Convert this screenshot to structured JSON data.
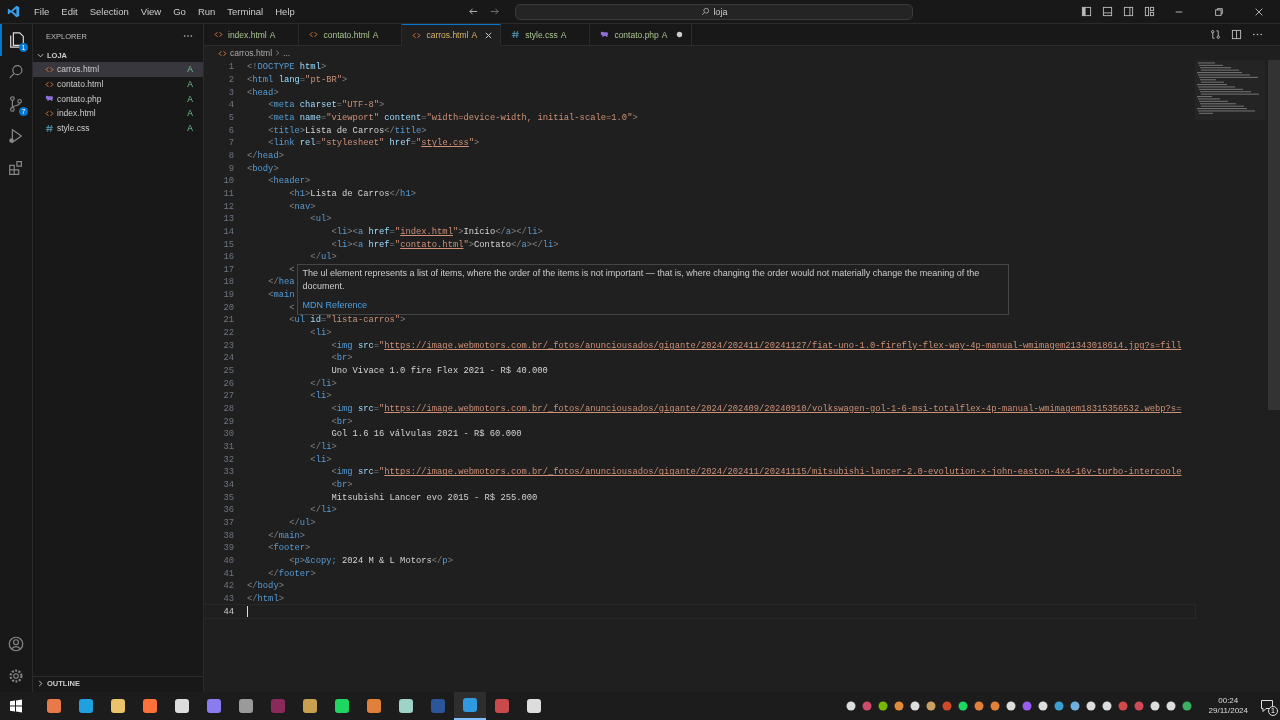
{
  "window": {
    "menu": [
      "File",
      "Edit",
      "Selection",
      "View",
      "Go",
      "Run",
      "Terminal",
      "Help"
    ],
    "search": "loja"
  },
  "activity_bar": {
    "explorer_badge": "1",
    "source_control_badge": "7"
  },
  "explorer": {
    "title": "EXPLORER",
    "folder": {
      "name": "LOJA",
      "expanded": true,
      "files": [
        {
          "name": "carros.html",
          "kind": "html",
          "badge": "A",
          "selected": true
        },
        {
          "name": "contato.html",
          "kind": "html",
          "badge": "A",
          "selected": false
        },
        {
          "name": "contato.php",
          "kind": "php",
          "badge": "A",
          "selected": false
        },
        {
          "name": "index.html",
          "kind": "html",
          "badge": "A",
          "selected": false
        },
        {
          "name": "style.css",
          "kind": "css",
          "badge": "A",
          "selected": false
        }
      ]
    }
  },
  "outline": {
    "label": "OUTLINE",
    "expanded": false
  },
  "tabs": [
    {
      "label": "index.html",
      "kind": "html",
      "badge": "A",
      "selected": false,
      "dirty": false
    },
    {
      "label": "contato.html",
      "kind": "html",
      "badge": "A",
      "selected": false,
      "dirty": false
    },
    {
      "label": "carros.html",
      "kind": "html",
      "badge": "A",
      "selected": true,
      "dirty": false
    },
    {
      "label": "style.css",
      "kind": "css",
      "badge": "A",
      "selected": false,
      "dirty": false
    },
    {
      "label": "contato.php",
      "kind": "php",
      "badge": "A",
      "selected": false,
      "dirty": true
    }
  ],
  "breadcrumb": [
    "carros.html",
    "..."
  ],
  "lines": [
    {
      "number": "1",
      "text": "<!DOCTYPE html>",
      "current": false
    },
    {
      "number": "2",
      "text": "<html lang=\"pt-BR\">",
      "current": false
    },
    {
      "number": "3",
      "text": "<head>",
      "current": false
    },
    {
      "number": "4",
      "text": "    <meta charset=\"UTF-8\">",
      "current": false
    },
    {
      "number": "5",
      "text": "    <meta name=\"viewport\" content=\"width=device-width, initial-scale=1.0\">",
      "current": false
    },
    {
      "number": "6",
      "text": "    <title>Lista de Carros</title>",
      "current": false
    },
    {
      "number": "7",
      "text": "    <link rel=\"stylesheet\" href=\"style.css\">",
      "current": false
    },
    {
      "number": "8",
      "text": "</head>",
      "current": false
    },
    {
      "number": "9",
      "text": "<body>",
      "current": false
    },
    {
      "number": "10",
      "text": "    <header>",
      "current": false
    },
    {
      "number": "11",
      "text": "        <h1>Lista de Carros</h1>",
      "current": false
    },
    {
      "number": "12",
      "text": "        <nav>",
      "current": false
    },
    {
      "number": "13",
      "text": "            <ul>",
      "current": false
    },
    {
      "number": "14",
      "text": "                <li><a href=\"index.html\">Início</a></li>",
      "current": false
    },
    {
      "number": "15",
      "text": "                <li><a href=\"contato.html\">Contato</a></li>",
      "current": false
    },
    {
      "number": "16",
      "text": "            </ul>",
      "current": false
    },
    {
      "number": "17",
      "text": "        <",
      "current": false
    },
    {
      "number": "18",
      "text": "    </hea",
      "current": false
    },
    {
      "number": "19",
      "text": "    <main",
      "current": false
    },
    {
      "number": "20",
      "text": "        <",
      "current": false
    },
    {
      "number": "21",
      "text": "        <ul id=\"lista-carros\">",
      "current": false
    },
    {
      "number": "22",
      "text": "            <li>",
      "current": false
    },
    {
      "number": "23",
      "text": "                <img src=\"https://image.webmotors.com.br/_fotos/anunciousados/gigante/2024/202411/20241127/fiat-uno-1.0-firefly-flex-way-4p-manual-wmimagem21343018614.jpg?s=fill",
      "current": false
    },
    {
      "number": "24",
      "text": "                <br>",
      "current": false
    },
    {
      "number": "25",
      "text": "                Uno Vivace 1.0 fire Flex 2021 - R$ 40.000",
      "current": false
    },
    {
      "number": "26",
      "text": "            </li>",
      "current": false
    },
    {
      "number": "27",
      "text": "            <li>",
      "current": false
    },
    {
      "number": "28",
      "text": "                <img src=\"https://image.webmotors.com.br/_fotos/anunciousados/gigante/2024/202409/20240910/volkswagen-gol-1-6-msi-totalflex-4p-manual-wmimagem18315356532.webp?s=",
      "current": false
    },
    {
      "number": "29",
      "text": "                <br>",
      "current": false
    },
    {
      "number": "30",
      "text": "                Gol 1.6 16 válvulas 2021 - R$ 60.000",
      "current": false
    },
    {
      "number": "31",
      "text": "            </li>",
      "current": false
    },
    {
      "number": "32",
      "text": "            <li>",
      "current": false
    },
    {
      "number": "33",
      "text": "                <img src=\"https://image.webmotors.com.br/_fotos/anunciousados/gigante/2024/202411/20241115/mitsubishi-lancer-2.0-evolution-x-john-easton-4x4-16v-turbo-intercoole",
      "current": false
    },
    {
      "number": "34",
      "text": "                <br>",
      "current": false
    },
    {
      "number": "35",
      "text": "                Mitsubishi Lancer evo 2015 - R$ 255.000",
      "current": false
    },
    {
      "number": "36",
      "text": "            </li>",
      "current": false
    },
    {
      "number": "37",
      "text": "        </ul>",
      "current": false
    },
    {
      "number": "38",
      "text": "    </main>",
      "current": false
    },
    {
      "number": "39",
      "text": "    <footer>",
      "current": false
    },
    {
      "number": "40",
      "text": "        <p>&copy; 2024 M & L Motors</p>",
      "current": false
    },
    {
      "number": "41",
      "text": "    </footer>",
      "current": false
    },
    {
      "number": "42",
      "text": "</body>",
      "current": false
    },
    {
      "number": "43",
      "text": "</html>",
      "current": false
    },
    {
      "number": "44",
      "current": true
    }
  ],
  "hover": {
    "text": "The ul element represents a list of items, where the order of the items is not important — that is, where changing the order would not materially change the meaning of the document.",
    "link": "MDN Reference"
  },
  "taskbar": {
    "time": "00:24",
    "date": "29/11/2024",
    "notifications": "1"
  }
}
